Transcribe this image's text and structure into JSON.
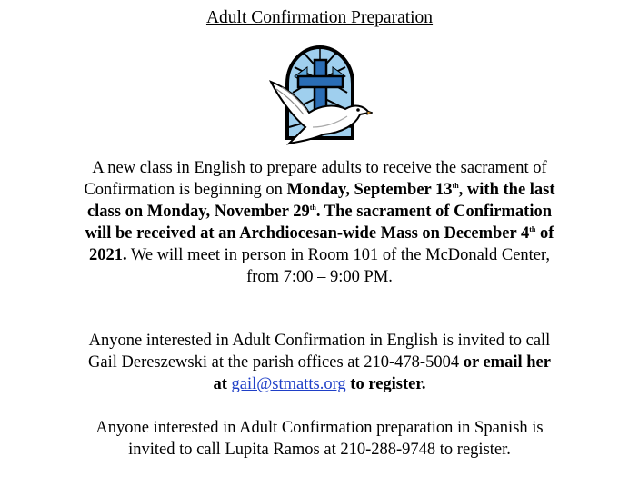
{
  "title": "Adult Confirmation Preparation",
  "image": {
    "icon": "stained-glass-dove-cross"
  },
  "paragraph1": {
    "t1": "A new class in English to prepare adults to receive the sacrament of Confirmation is beginning on ",
    "b1": "Monday, September 13",
    "b1_sup": "th",
    "b2": ", with the last class on Monday, November 29",
    "b2_sup": "th",
    "b3": ". The sacrament of Confirmation will be received at an Archdiocesan-wide Mass on December 4",
    "b3_sup": "th",
    "b4": " of 2021.",
    "t2": "  We will meet in person in Room 101 of the McDonald Center, from 7:00 – 9:00 PM."
  },
  "paragraph2": {
    "t1": "Anyone interested in Adult Confirmation in English is invited to call Gail Dereszewski at the parish offices at 210-478-5004 ",
    "b1": "or email her at ",
    "email": "gail@stmatts.org",
    "b2": " to register."
  },
  "paragraph3": {
    "text": "Anyone interested in Adult Confirmation preparation in Spanish is invited to call Lupita Ramos at 210-288-9748 to register."
  },
  "colors": {
    "link": "#1f3fc7",
    "cross": "#2a6db5",
    "glass_light": "#9fcfee",
    "glass_mid": "#5da7dc"
  }
}
